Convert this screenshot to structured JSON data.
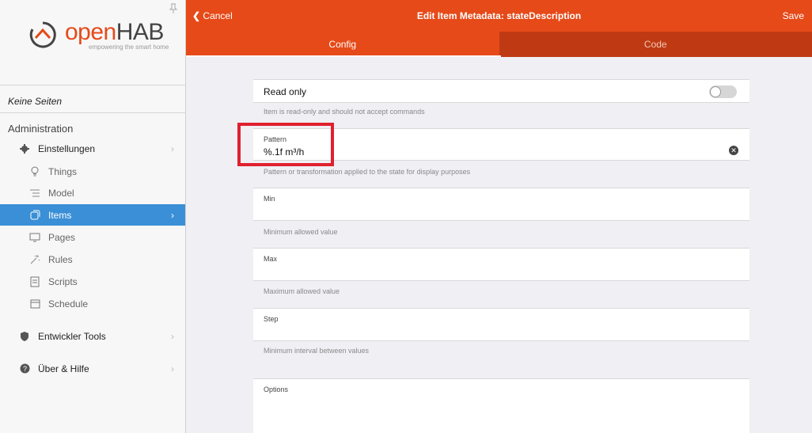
{
  "sidebar": {
    "logo": {
      "name_open": "open",
      "name_hab": "HAB",
      "tagline": "empowering the smart home"
    },
    "no_pages": "Keine Seiten",
    "section_title": "Administration",
    "items": [
      {
        "label": "Einstellungen",
        "icon": "gear-icon"
      },
      {
        "label": "Things",
        "icon": "bulb-icon"
      },
      {
        "label": "Model",
        "icon": "list-icon"
      },
      {
        "label": "Items",
        "icon": "items-icon"
      },
      {
        "label": "Pages",
        "icon": "monitor-icon"
      },
      {
        "label": "Rules",
        "icon": "wand-icon"
      },
      {
        "label": "Scripts",
        "icon": "doc-icon"
      },
      {
        "label": "Schedule",
        "icon": "calendar-icon"
      },
      {
        "label": "Entwickler Tools",
        "icon": "shield-icon"
      },
      {
        "label": "Über & Hilfe",
        "icon": "help-icon"
      }
    ]
  },
  "header": {
    "cancel": "Cancel",
    "title": "Edit Item Metadata: stateDescription",
    "save": "Save",
    "tabs": [
      {
        "label": "Config"
      },
      {
        "label": "Code"
      }
    ]
  },
  "form": {
    "read_only": {
      "label": "Read only",
      "help": "Item is read-only and should not accept commands",
      "value": false
    },
    "pattern": {
      "label": "Pattern",
      "value": "%.1f m³/h",
      "help": "Pattern or transformation applied to the state for display purposes"
    },
    "min": {
      "label": "Min",
      "value": "",
      "help": "Minimum allowed value"
    },
    "max": {
      "label": "Max",
      "value": "",
      "help": "Maximum allowed value"
    },
    "step": {
      "label": "Step",
      "value": "",
      "help": "Minimum interval between values"
    },
    "options": {
      "label": "Options",
      "value": ""
    }
  },
  "colors": {
    "brand": "#e64a19",
    "active": "#3a8fd6",
    "highlight": "#e0202e"
  }
}
